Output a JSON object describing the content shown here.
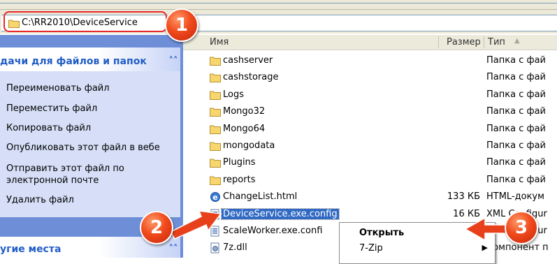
{
  "address_bar": {
    "path": "C:\\RR2010\\DeviceService"
  },
  "task_pane": {
    "header": "дачи для файлов и папок",
    "items": [
      "Переименовать файл",
      "Переместить файл",
      "Копировать файл",
      "Опубликовать этот файл в вебе",
      "Отправить этот файл по",
      "электронной почте",
      "Удалить файл"
    ],
    "other_header": "угие места"
  },
  "columns": {
    "name": "Имя",
    "size": "Размер",
    "type": "Тип"
  },
  "files": [
    {
      "name": "cashserver",
      "size": "",
      "type": "Папка с фай",
      "icon": "folder-icon"
    },
    {
      "name": "cashstorage",
      "size": "",
      "type": "Папка с фай",
      "icon": "folder-icon"
    },
    {
      "name": "Logs",
      "size": "",
      "type": "Папка с фай",
      "icon": "folder-icon"
    },
    {
      "name": "Mongo32",
      "size": "",
      "type": "Папка с фай",
      "icon": "folder-icon"
    },
    {
      "name": "Mongo64",
      "size": "",
      "type": "Папка с фай",
      "icon": "folder-icon"
    },
    {
      "name": "mongodata",
      "size": "",
      "type": "Папка с фай",
      "icon": "folder-icon"
    },
    {
      "name": "Plugins",
      "size": "",
      "type": "Папка с фай",
      "icon": "folder-icon"
    },
    {
      "name": "reports",
      "size": "",
      "type": "Папка с фай",
      "icon": "folder-icon"
    },
    {
      "name": "ChangeList.html",
      "size": "133 КБ",
      "type": "HTML-докум",
      "icon": "html-file-icon"
    },
    {
      "name": "DeviceService.exe.config",
      "size": "16 КБ",
      "type": "XML Configur",
      "icon": "config-file-icon"
    },
    {
      "name": "ScaleWorker.exe.confi",
      "size": "",
      "type": "XML Configur",
      "icon": "config-file-icon"
    },
    {
      "name": "7z.dll",
      "size": "",
      "type": "Компонент п",
      "icon": "dll-file-icon"
    }
  ],
  "context_menu": {
    "items": [
      "Открыть",
      "7-Zip"
    ]
  },
  "badges": [
    "1",
    "2",
    "3"
  ],
  "colors": {
    "accent": "#316ac5",
    "badge": "#e8401a",
    "task_link": "#215dc6"
  }
}
